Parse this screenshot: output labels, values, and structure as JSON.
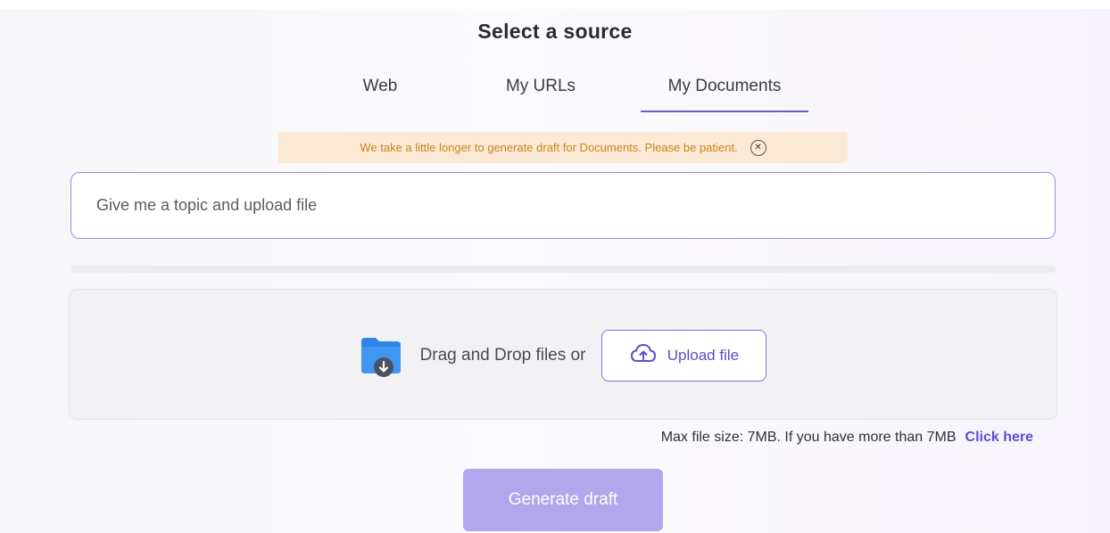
{
  "header": {
    "title": "Select a source"
  },
  "tabs": [
    {
      "label": "Web",
      "active": false
    },
    {
      "label": "My URLs",
      "active": false
    },
    {
      "label": "My Documents",
      "active": true
    }
  ],
  "notice": {
    "text": "We take a little longer to generate draft for Documents. Please be patient.",
    "icon": "close-circle-icon"
  },
  "topic_input": {
    "placeholder": "Give me a topic and upload file",
    "value": ""
  },
  "dropzone": {
    "icon": "folder-download-icon",
    "text": "Drag and Drop files or",
    "upload_label": "Upload file",
    "upload_icon": "cloud-upload-icon"
  },
  "max_size": {
    "text": "Max file size: 7MB. If you have more than 7MB",
    "link": "Click here"
  },
  "generate": {
    "label": "Generate draft"
  },
  "colors": {
    "accent": "#6a5fd0",
    "notice_bg": "#fbe9d6",
    "notice_text": "#c8861a",
    "generate_bg": "#b2a6ec"
  }
}
